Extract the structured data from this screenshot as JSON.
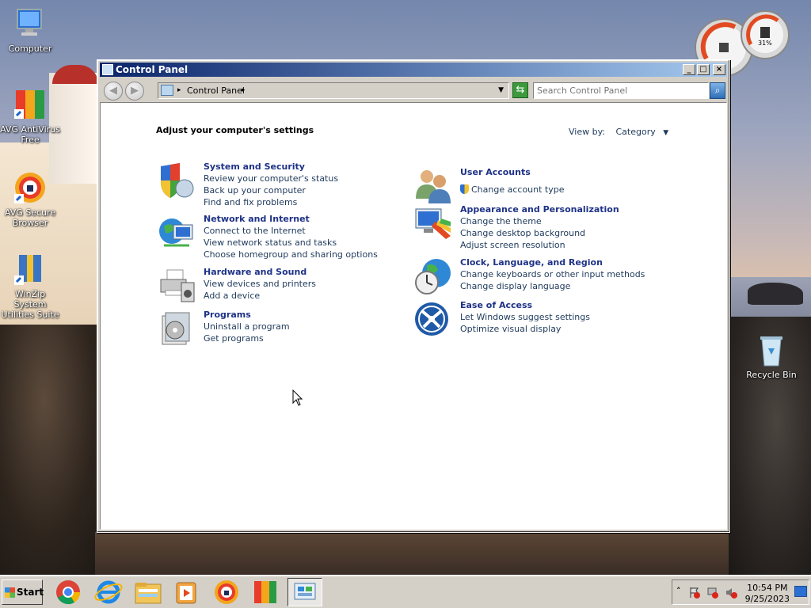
{
  "desktop": {
    "icons": [
      {
        "label": "Computer",
        "icon": "computer-icon"
      },
      {
        "label": "AVG AntiVirus Free",
        "icon": "avg-antivirus-icon"
      },
      {
        "label": "AVG Secure Browser",
        "icon": "avg-browser-icon"
      },
      {
        "label": "WinZip System Utilities Suite",
        "icon": "winzip-icon"
      },
      {
        "label": "Recycle Bin",
        "icon": "recycle-bin-icon"
      }
    ],
    "gadget": {
      "value": "31%"
    }
  },
  "window": {
    "title": "Control Panel",
    "address": {
      "crumb": "Control Panel"
    },
    "search": {
      "placeholder": "Search Control Panel"
    },
    "heading": "Adjust your computer's settings",
    "view_by": {
      "label": "View by:",
      "value": "Category"
    },
    "categories_left": [
      {
        "title": "System and Security",
        "icon": "shield-icon",
        "links": [
          "Review your computer's status",
          "Back up your computer",
          "Find and fix problems"
        ]
      },
      {
        "title": "Network and Internet",
        "icon": "network-globe-icon",
        "links": [
          "Connect to the Internet",
          "View network status and tasks",
          "Choose homegroup and sharing options"
        ]
      },
      {
        "title": "Hardware and Sound",
        "icon": "printer-icon",
        "links": [
          "View devices and printers",
          "Add a device"
        ]
      },
      {
        "title": "Programs",
        "icon": "programs-icon",
        "links": [
          "Uninstall a program",
          "Get programs"
        ]
      }
    ],
    "categories_right": [
      {
        "title": "User Accounts",
        "icon": "users-icon",
        "links": [
          "Change account type"
        ]
      },
      {
        "title": "Appearance and Personalization",
        "icon": "monitor-palette-icon",
        "links": [
          "Change the theme",
          "Change desktop background",
          "Adjust screen resolution"
        ]
      },
      {
        "title": "Clock, Language, and Region",
        "icon": "clock-globe-icon",
        "links": [
          "Change keyboards or other input methods",
          "Change display language"
        ]
      },
      {
        "title": "Ease of Access",
        "icon": "ease-of-access-icon",
        "links": [
          "Let Windows suggest settings",
          "Optimize visual display"
        ]
      }
    ]
  },
  "taskbar": {
    "start_label": "Start",
    "apps": [
      "chrome-icon",
      "internet-explorer-icon",
      "file-explorer-icon",
      "media-player-icon",
      "avg-browser-icon",
      "avg-antivirus-icon",
      "control-panel-icon"
    ],
    "clock": {
      "time": "10:54 PM",
      "date": "9/25/2023"
    }
  },
  "colors": {
    "link_title": "#1e3287",
    "link": "#1e395b",
    "titlebar": "#0a246a"
  }
}
